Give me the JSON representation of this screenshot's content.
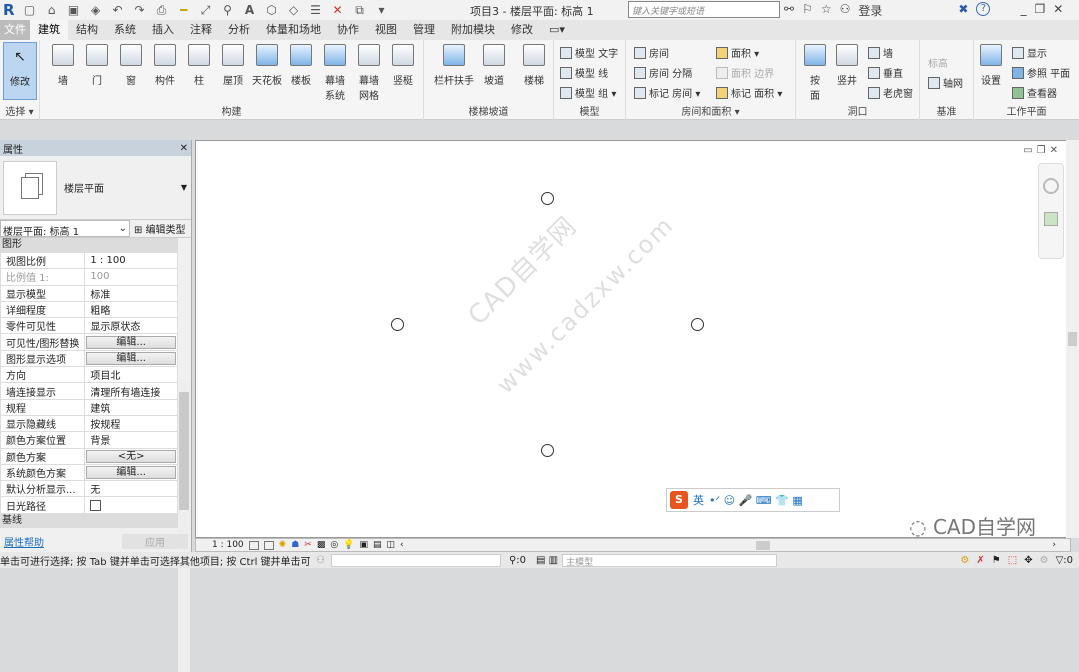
{
  "titlebar": {
    "logo": "R",
    "title": "项目3 - 楼层平面: 标高 1",
    "search_placeholder": "键入关键字或短语",
    "login": "登录",
    "help": "?"
  },
  "tabs": [
    "文件",
    "建筑",
    "结构",
    "系统",
    "插入",
    "注释",
    "分析",
    "体量和场地",
    "协作",
    "视图",
    "管理",
    "附加模块",
    "修改"
  ],
  "ribbon": {
    "select": {
      "modify": "修改",
      "label": "选择 ▾"
    },
    "build": {
      "label": "构建",
      "buttons": [
        "墙",
        "门",
        "窗",
        "构件",
        "柱",
        "屋顶",
        "天花板",
        "楼板",
        "幕墙\n系统",
        "幕墙\n网格",
        "竖梃"
      ]
    },
    "stairs": {
      "label": "楼梯坡道",
      "buttons": [
        "栏杆扶手",
        "坡道",
        "楼梯"
      ]
    },
    "model": {
      "label": "模型",
      "items": [
        "模型 文字",
        "模型 线",
        "模型 组 ▾"
      ]
    },
    "room": {
      "label": "房间和面积 ▾",
      "items": [
        "房间",
        "房间 分隔",
        "标记 房间 ▾",
        "面积 ▾",
        "面积 边界",
        "标记 面积 ▾"
      ]
    },
    "opening": {
      "label": "洞口",
      "buttons": [
        "按\n面",
        "竖井"
      ],
      "items": [
        "墙",
        "垂直",
        "老虎窗"
      ]
    },
    "datum": {
      "label": "基准",
      "items": [
        "标高",
        "轴网"
      ]
    },
    "workplane": {
      "label": "工作平面",
      "button": "设置",
      "items": [
        "显示",
        "参照 平面",
        "查看器"
      ]
    }
  },
  "properties": {
    "title": "属性",
    "type_name": "楼层平面",
    "selector": "楼层平面: 标高 1",
    "edit_type": "编辑类型",
    "group1": "图形",
    "group2": "基线",
    "rows": [
      {
        "k": "视图比例",
        "v": "1 : 100"
      },
      {
        "k": "比例值 1:",
        "v": "100",
        "disabled": true
      },
      {
        "k": "显示模型",
        "v": "标准"
      },
      {
        "k": "详细程度",
        "v": "粗略"
      },
      {
        "k": "零件可见性",
        "v": "显示原状态"
      },
      {
        "k": "可见性/图形替换",
        "v": "编辑...",
        "button": true
      },
      {
        "k": "图形显示选项",
        "v": "编辑...",
        "button": true
      },
      {
        "k": "方向",
        "v": "项目北"
      },
      {
        "k": "墙连接显示",
        "v": "清理所有墙连接"
      },
      {
        "k": "规程",
        "v": "建筑"
      },
      {
        "k": "显示隐藏线",
        "v": "按规程"
      },
      {
        "k": "颜色方案位置",
        "v": "背景"
      },
      {
        "k": "颜色方案",
        "v": "<无>",
        "button": true
      },
      {
        "k": "系统颜色方案",
        "v": "编辑...",
        "button": true
      },
      {
        "k": "默认分析显示...",
        "v": "无"
      },
      {
        "k": "日光路径",
        "v": "",
        "checkbox": true
      }
    ],
    "help": "属性帮助",
    "apply": "应用"
  },
  "canvas": {
    "watermark1": "CAD自学网",
    "watermark2": "www.cadzxw.com",
    "ime": "英",
    "wechat": "CAD自学网"
  },
  "view_control": {
    "scale": "1 : 100"
  },
  "status": {
    "message": "单击可进行选择; 按 Tab 键并单击可选择其他项目; 按 Ctrl 键并单击可",
    "zero1": ":0",
    "model": "主模型",
    "zero2": ":0"
  }
}
